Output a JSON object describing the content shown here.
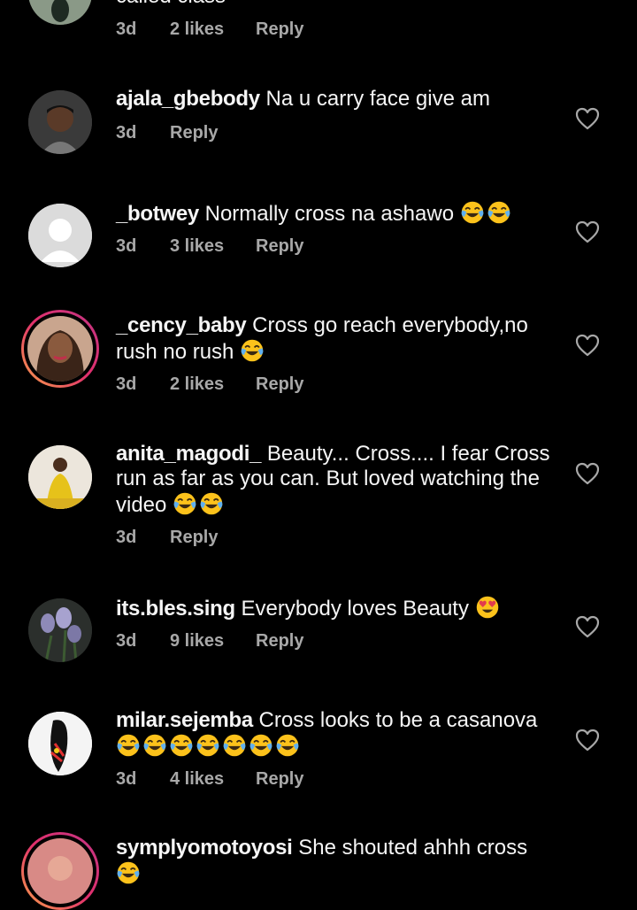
{
  "comments": [
    {
      "time": "3d",
      "likes": "2 likes",
      "reply": "Reply"
    },
    {
      "username": "ajala_gbebody",
      "text": "Na u carry face give am",
      "time": "3d",
      "reply": "Reply"
    },
    {
      "username": "_botwey",
      "text": "Normally cross na ashawo",
      "time": "3d",
      "likes": "3 likes",
      "reply": "Reply"
    },
    {
      "username": "_cency_baby",
      "text": "Cross go reach everybody,no rush no rush",
      "time": "3d",
      "likes": "2 likes",
      "reply": "Reply"
    },
    {
      "username": "anita_magodi_",
      "text": "Beauty... Cross.... I fear Cross run as far as you can. But loved watching the video",
      "time": "3d",
      "reply": "Reply"
    },
    {
      "username": "its.bles.sing",
      "text": "Everybody loves Beauty",
      "time": "3d",
      "likes": "9 likes",
      "reply": "Reply"
    },
    {
      "username": "milar.sejemba",
      "text": "Cross looks to be a casanova",
      "time": "3d",
      "likes": "4 likes",
      "reply": "Reply"
    },
    {
      "username": "symplyomotoyosi",
      "text": "She shouted ahhh cross"
    }
  ],
  "partial_text": "called class",
  "colors": {
    "background": "#000000",
    "text": "#f5f5f5",
    "meta": "#a8a8a8",
    "story_ring": "#e1306c"
  },
  "icons": {
    "like": "heart-outline-icon",
    "laugh": "face-with-tears-of-joy-emoji",
    "love": "smiling-face-with-heart-eyes-emoji"
  }
}
